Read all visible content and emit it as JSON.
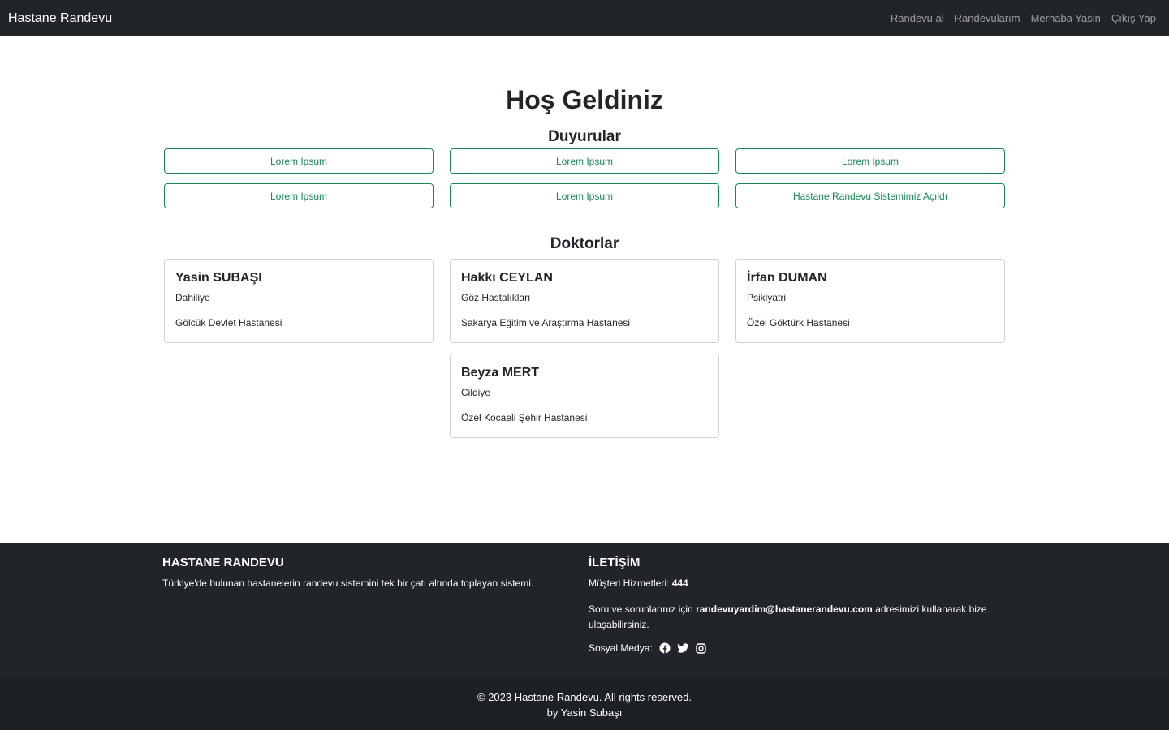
{
  "navbar": {
    "brand": "Hastane Randevu",
    "links": [
      "Randevu al",
      "Randevularım",
      "Merhaba Yasin",
      "Çıkış Yap"
    ]
  },
  "main": {
    "welcome": "Hoş Geldiniz",
    "announcements_title": "Duyurular",
    "announcements": [
      "Lorem Ipsum",
      "Lorem Ipsum",
      "Lorem Ipsum",
      "Lorem Ipsum",
      "Lorem Ipsum",
      "Hastane Randevu Sistemimiz Açıldı"
    ],
    "doctors_title": "Doktorlar",
    "doctors": [
      {
        "name": "Yasin SUBAŞI",
        "specialty": "Dahiliye",
        "hospital": "Gölcük Devlet Hastanesi"
      },
      {
        "name": "Hakkı CEYLAN",
        "specialty": "Göz Hastalıkları",
        "hospital": "Sakarya Eğitim ve Araştırma Hastanesi"
      },
      {
        "name": "İrfan DUMAN",
        "specialty": "Psikiyatri",
        "hospital": "Özel Göktürk Hastanesi"
      },
      {
        "name": "Beyza MERT",
        "specialty": "Cildiye",
        "hospital": "Özel Kocaeli Şehir Hastanesi"
      }
    ]
  },
  "footer": {
    "about_title": "HASTANE RANDEVU",
    "about_text": "Türkiye'de bulunan hastanelerin randevu sistemini tek bir çatı altında toplayan sistemi.",
    "contact_title": "İLETİŞİM",
    "customer_service_label": "Müşteri Hizmetleri:",
    "customer_service_number": "444",
    "support_prefix": "Soru ve sorunlarınız için",
    "support_email": "randevuyardim@hastanerandevu.com",
    "support_suffix": "adresimizi kullanarak bize ulaşabilirsiniz.",
    "social_label": "Sosyal Medya:",
    "social_icons": [
      "facebook-icon",
      "twitter-icon",
      "instagram-icon"
    ]
  },
  "copyright": {
    "line1": "© 2023 Hastane Randevu. All rights reserved.",
    "line2": "by Yasin Subaşı"
  },
  "colors": {
    "navbar": "#212529",
    "accent": "#198754",
    "footer": "#212529"
  }
}
